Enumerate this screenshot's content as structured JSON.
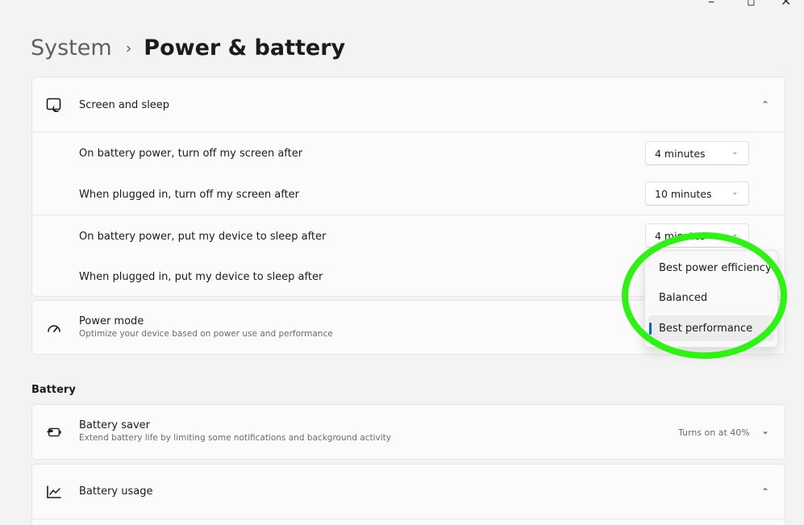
{
  "window": {
    "minimize_glyph": "–",
    "maximize_glyph": "▫",
    "close_glyph": "✕"
  },
  "breadcrumb": {
    "parent": "System",
    "separator": "›",
    "current": "Power & battery"
  },
  "screen_sleep": {
    "title": "Screen and sleep",
    "icon": "screen-sleep-icon",
    "expanded_glyph": "⌃",
    "items": [
      {
        "label": "On battery power, turn off my screen after",
        "value": "4 minutes"
      },
      {
        "label": "When plugged in, turn off my screen after",
        "value": "10 minutes"
      },
      {
        "label": "On battery power, put my device to sleep after",
        "value": "4 minutes"
      },
      {
        "label": "When plugged in, put my device to sleep after",
        "value": ""
      }
    ],
    "dropdown_glyph": "⌄"
  },
  "power_mode": {
    "title": "Power mode",
    "subtitle": "Optimize your device based on power use and performance",
    "icon": "power-mode-gauge-icon",
    "options": [
      "Best power efficiency",
      "Balanced",
      "Best performance"
    ],
    "selected": "Best performance"
  },
  "battery_section": {
    "label": "Battery",
    "saver": {
      "title": "Battery saver",
      "subtitle": "Extend battery life by limiting some notifications and background activity",
      "status": "Turns on at 40%",
      "icon": "battery-saver-icon",
      "chevron_glyph": "⌄"
    },
    "usage": {
      "title": "Battery usage",
      "icon": "battery-usage-chart-icon",
      "chevron_glyph": "⌃"
    }
  },
  "colors": {
    "accent": "#0067c0",
    "annotation": "#2ef212",
    "background": "#f3f3f3",
    "card": "#fbfbfb"
  }
}
